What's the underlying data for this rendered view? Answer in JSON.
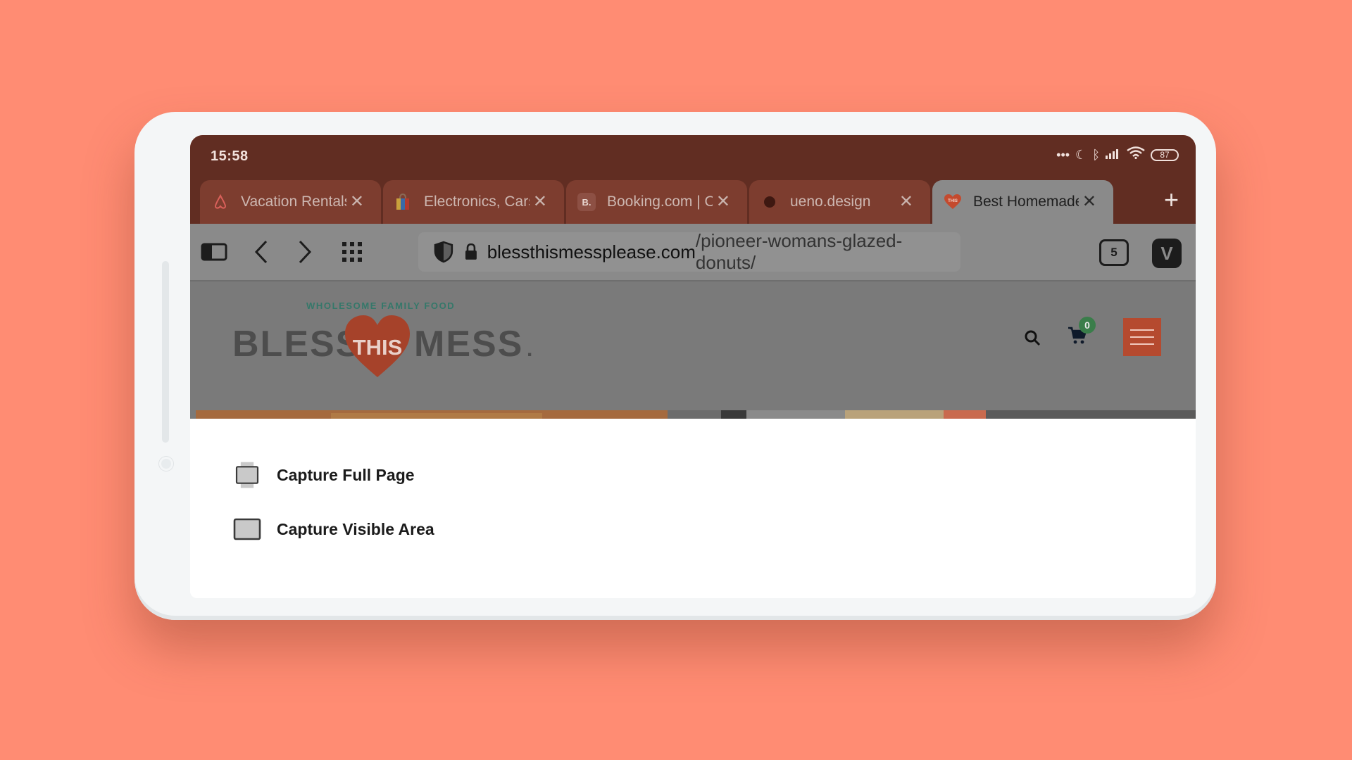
{
  "status": {
    "time": "15:58",
    "battery": "87"
  },
  "tabs": [
    {
      "title": "Vacation Rentals",
      "icon": "airbnb-icon"
    },
    {
      "title": "Electronics, Cars",
      "icon": "shopping-bag-icon"
    },
    {
      "title": "Booking.com | Official site",
      "icon": "booking-icon",
      "icon_text": "B."
    },
    {
      "title": "ueno.design",
      "icon": "dot-icon"
    },
    {
      "title": "Best Homemade Donuts",
      "icon": "bless-this-mess-icon",
      "active": true
    }
  ],
  "toolbar": {
    "url_domain": "blessthismessplease.com",
    "url_path": "/pioneer-womans-glazed-donuts/",
    "tab_count": "5",
    "browser_icon": "V"
  },
  "site": {
    "tagline": "WHOLESOME FAMILY FOOD",
    "logo_left": "BLESS",
    "logo_middle": "THIS",
    "logo_right": "MESS",
    "logo_reg": ".",
    "cart_count": "0"
  },
  "capture_menu": {
    "full_page_label": "Capture Full Page",
    "visible_area_label": "Capture Visible Area"
  },
  "colors": {
    "background": "#ff8c73",
    "status_bar": "#612d22",
    "active_tab": "#8a8a8a",
    "brand_heart": "#c44a2e"
  }
}
